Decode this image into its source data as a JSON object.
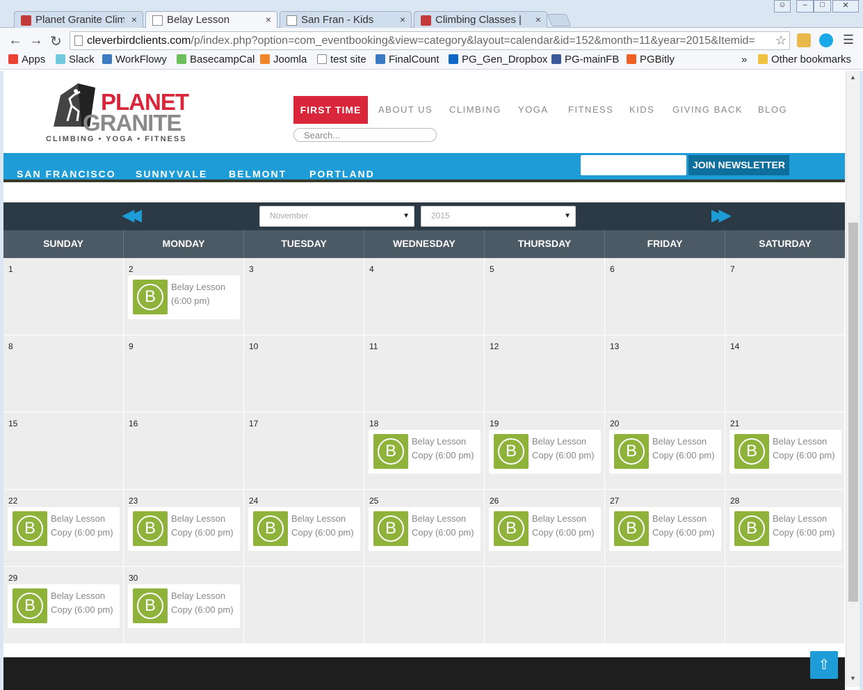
{
  "browser": {
    "tabs": [
      {
        "title": "Planet Granite Climb",
        "favicon": "planet-granite-favicon",
        "active": false
      },
      {
        "title": "Belay Lesson",
        "favicon": "page-icon",
        "active": true
      },
      {
        "title": "San Fran - Kids",
        "favicon": "page-icon",
        "active": false
      },
      {
        "title": "Climbing Classes | Pl",
        "favicon": "planet-granite-favicon",
        "active": false
      }
    ],
    "tab_close": "×",
    "url_host": "cleverbirdclients.com",
    "url_path": "/p/index.php?option=com_eventbooking&view=category&layout=calendar&id=152&month=11&year=2015&Itemid=",
    "bookmarks": [
      {
        "label": "Apps",
        "color": "#e94235"
      },
      {
        "label": "Slack",
        "color": "#6ecadc"
      },
      {
        "label": "WorkFlowy",
        "color": "#3b7bc4"
      },
      {
        "label": "BasecampCal",
        "color": "#6cbf5a"
      },
      {
        "label": "Joomla",
        "color": "#f1852a"
      },
      {
        "label": "test site",
        "color": "#ffffff"
      },
      {
        "label": "FinalCount",
        "color": "#3b7bc4"
      },
      {
        "label": "PG_Gen_Dropbox",
        "color": "#0d68c8"
      },
      {
        "label": "PG-mainFB",
        "color": "#3b5998"
      },
      {
        "label": "PGBitly",
        "color": "#ee6123"
      }
    ],
    "bookmarks_overflow": "»",
    "other_bookmarks": "Other bookmarks"
  },
  "site": {
    "logo_planet": "PLANET",
    "logo_granite": "GRANITE",
    "logo_tagline": "CLIMBING • YOGA • FITNESS",
    "first_time": "FIRST TIME",
    "nav": [
      "ABOUT US",
      "CLIMBING",
      "YOGA",
      "FITNESS",
      "KIDS",
      "GIVING BACK",
      "BLOG"
    ],
    "search_placeholder": "Search...",
    "locations": [
      "SAN FRANCISCO",
      "SUNNYVALE",
      "BELMONT",
      "PORTLAND"
    ],
    "newsletter_button": "JOIN NEWSLETTER",
    "accent_red": "#d9263b",
    "accent_blue": "#1d9cd8",
    "event_green": "#8fb33a"
  },
  "calendar": {
    "prev": "◀◀",
    "next": "▶▶",
    "month_select": "November",
    "year_select": "2015",
    "day_names": [
      "SUNDAY",
      "MONDAY",
      "TUESDAY",
      "WEDNESDAY",
      "THURSDAY",
      "FRIDAY",
      "SATURDAY"
    ],
    "badge_letter": "B",
    "weeks": [
      [
        {
          "d": "1"
        },
        {
          "d": "2",
          "ev": [
            "Belay Lesson",
            "(6:00 pm)"
          ]
        },
        {
          "d": "3"
        },
        {
          "d": "4"
        },
        {
          "d": "5"
        },
        {
          "d": "6"
        },
        {
          "d": "7"
        }
      ],
      [
        {
          "d": "8"
        },
        {
          "d": "9"
        },
        {
          "d": "10"
        },
        {
          "d": "11"
        },
        {
          "d": "12"
        },
        {
          "d": "13"
        },
        {
          "d": "14"
        }
      ],
      [
        {
          "d": "15"
        },
        {
          "d": "16"
        },
        {
          "d": "17"
        },
        {
          "d": "18",
          "ev": [
            "Belay Lesson",
            "Copy (6:00 pm)"
          ]
        },
        {
          "d": "19",
          "ev": [
            "Belay Lesson",
            "Copy (6:00 pm)"
          ]
        },
        {
          "d": "20",
          "ev": [
            "Belay Lesson",
            "Copy (6:00 pm)"
          ]
        },
        {
          "d": "21",
          "ev": [
            "Belay Lesson",
            "Copy (6:00 pm)"
          ]
        }
      ],
      [
        {
          "d": "22",
          "ev": [
            "Belay Lesson",
            "Copy (6:00 pm)"
          ]
        },
        {
          "d": "23",
          "ev": [
            "Belay Lesson",
            "Copy (6:00 pm)"
          ]
        },
        {
          "d": "24",
          "ev": [
            "Belay Lesson",
            "Copy (6:00 pm)"
          ]
        },
        {
          "d": "25",
          "ev": [
            "Belay Lesson",
            "Copy (6:00 pm)"
          ]
        },
        {
          "d": "26",
          "ev": [
            "Belay Lesson",
            "Copy (6:00 pm)"
          ]
        },
        {
          "d": "27",
          "ev": [
            "Belay Lesson",
            "Copy (6:00 pm)"
          ]
        },
        {
          "d": "28",
          "ev": [
            "Belay Lesson",
            "Copy (6:00 pm)"
          ]
        }
      ],
      [
        {
          "d": "29",
          "ev": [
            "Belay Lesson",
            "Copy (6:00 pm)"
          ]
        },
        {
          "d": "30",
          "ev": [
            "Belay Lesson",
            "Copy (6:00 pm)"
          ]
        },
        {
          "d": ""
        },
        {
          "d": ""
        },
        {
          "d": ""
        },
        {
          "d": ""
        },
        {
          "d": ""
        }
      ]
    ]
  }
}
